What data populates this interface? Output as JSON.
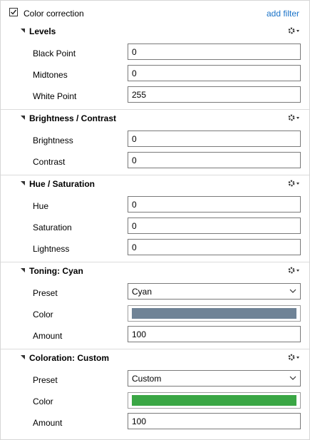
{
  "panel": {
    "title": "Color correction",
    "enabled": true,
    "add_filter": "add filter"
  },
  "sections": [
    {
      "title": "Levels",
      "rows": [
        {
          "label": "Black Point",
          "value": "0"
        },
        {
          "label": "Midtones",
          "value": "0"
        },
        {
          "label": "White Point",
          "value": "255"
        }
      ]
    },
    {
      "title": "Brightness / Contrast",
      "rows": [
        {
          "label": "Brightness",
          "value": "0"
        },
        {
          "label": "Contrast",
          "value": "0"
        }
      ]
    },
    {
      "title": "Hue / Saturation",
      "rows": [
        {
          "label": "Hue",
          "value": "0"
        },
        {
          "label": "Saturation",
          "value": "0"
        },
        {
          "label": "Lightness",
          "value": "0"
        }
      ]
    },
    {
      "title": "Toning: Cyan",
      "preset_label": "Preset",
      "preset_value": "Cyan",
      "color_label": "Color",
      "color": "#6f8396",
      "amount_label": "Amount",
      "amount_value": "100"
    },
    {
      "title": "Coloration: Custom",
      "preset_label": "Preset",
      "preset_value": "Custom",
      "color_label": "Color",
      "color": "#3aa644",
      "amount_label": "Amount",
      "amount_value": "100"
    }
  ]
}
